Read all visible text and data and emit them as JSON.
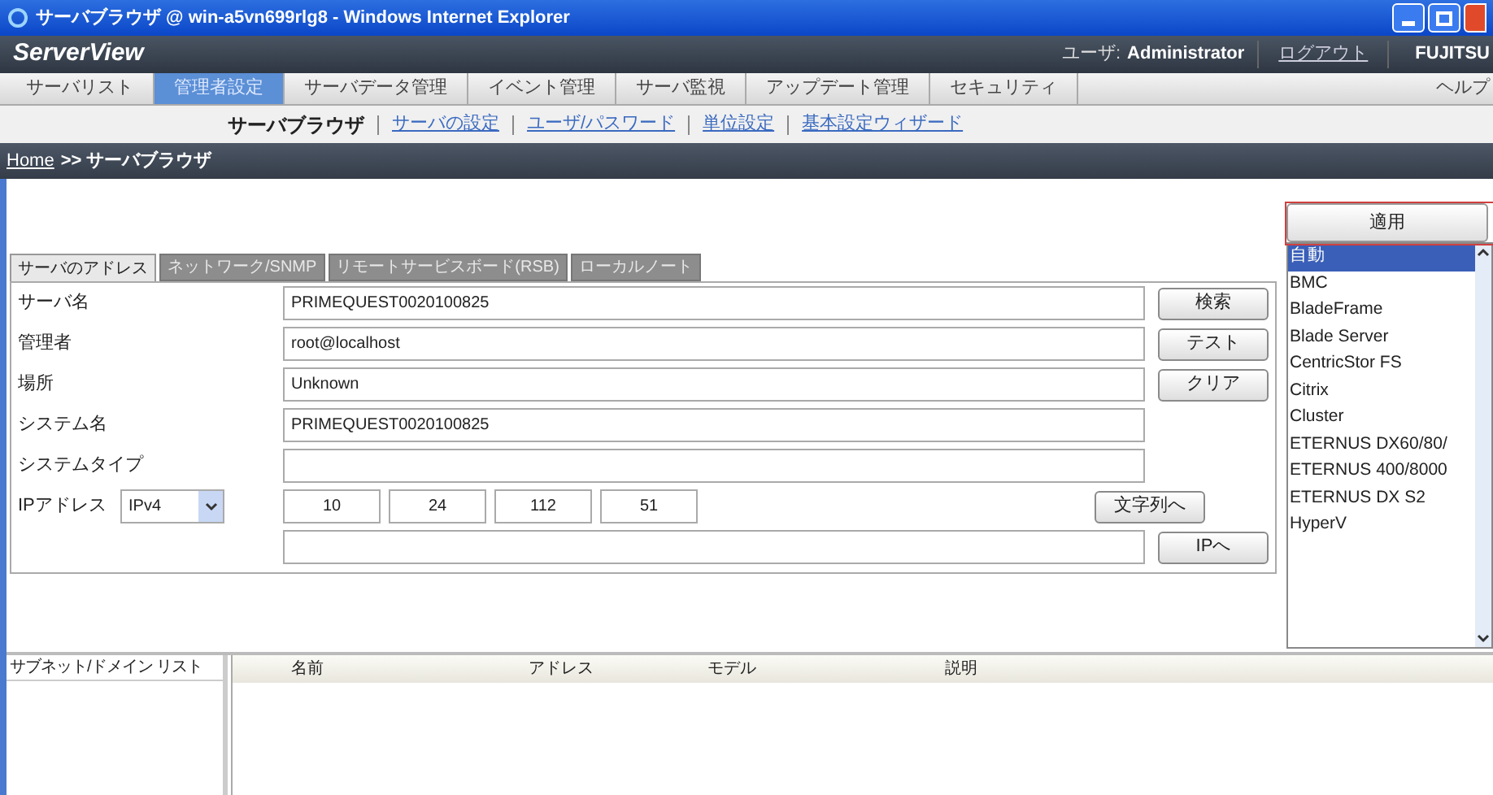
{
  "window": {
    "title": "サーバブラウザ @ win-a5vn699rlg8 - Windows Internet Explorer"
  },
  "header": {
    "logo": "ServerView",
    "user_label": "ユーザ:",
    "user": "Administrator",
    "logout": "ログアウト",
    "brand": "FUJITSU"
  },
  "main_tabs": [
    {
      "label": "サーバリスト",
      "selected": false
    },
    {
      "label": "管理者設定",
      "selected": true
    },
    {
      "label": "サーバデータ管理",
      "selected": false
    },
    {
      "label": "イベント管理",
      "selected": false
    },
    {
      "label": "サーバ監視",
      "selected": false
    },
    {
      "label": "アップデート管理",
      "selected": false
    },
    {
      "label": "セキュリティ",
      "selected": false
    }
  ],
  "help": "ヘルプ",
  "sub_nav": [
    {
      "label": "サーバブラウザ",
      "selected": true
    },
    {
      "label": "サーバの設定",
      "selected": false
    },
    {
      "label": "ユーザ/パスワード",
      "selected": false
    },
    {
      "label": "単位設定",
      "selected": false
    },
    {
      "label": "基本設定ウィザード",
      "selected": false
    }
  ],
  "breadcrumb": {
    "home": "Home",
    "current": ">> サーバブラウザ"
  },
  "form_tabs": [
    {
      "label": "サーバのアドレス",
      "selected": true
    },
    {
      "label": "ネットワーク/SNMP",
      "selected": false
    },
    {
      "label": "リモートサービスボード(RSB)",
      "selected": false
    },
    {
      "label": "ローカルノート",
      "selected": false
    }
  ],
  "fields": [
    {
      "label": "サーバ名",
      "value": "PRIMEQUEST0020100825",
      "button": "検索"
    },
    {
      "label": "管理者",
      "value": "root@localhost",
      "button": "テスト"
    },
    {
      "label": "場所",
      "value": "Unknown",
      "button": "クリア"
    },
    {
      "label": "システム名",
      "value": "PRIMEQUEST0020100825"
    },
    {
      "label": "システムタイプ"
    }
  ],
  "ip": {
    "label": "IPアドレス",
    "version": "IPv4",
    "octets": [
      "10",
      "24",
      "112",
      "51"
    ],
    "button": "文字列へ",
    "second_button": "IPへ"
  },
  "apply_button": "適用",
  "type_list": [
    {
      "label": "自動",
      "selected": true
    },
    {
      "label": "BMC",
      "selected": false
    },
    {
      "label": "BladeFrame",
      "selected": false
    },
    {
      "label": "Blade Server",
      "selected": false
    },
    {
      "label": "CentricStor FS",
      "selected": false
    },
    {
      "label": "Citrix",
      "selected": false
    },
    {
      "label": "Cluster",
      "selected": false
    },
    {
      "label": "ETERNUS DX60/80/",
      "selected": false
    },
    {
      "label": "ETERNUS 400/8000",
      "selected": false
    },
    {
      "label": "ETERNUS DX S2",
      "selected": false
    },
    {
      "label": "HyperV",
      "selected": false
    }
  ],
  "subnet_list": {
    "title": "サブネット/ドメイン リスト"
  },
  "table": {
    "columns": [
      "名前",
      "アドレス",
      "モデル",
      "説明"
    ]
  }
}
